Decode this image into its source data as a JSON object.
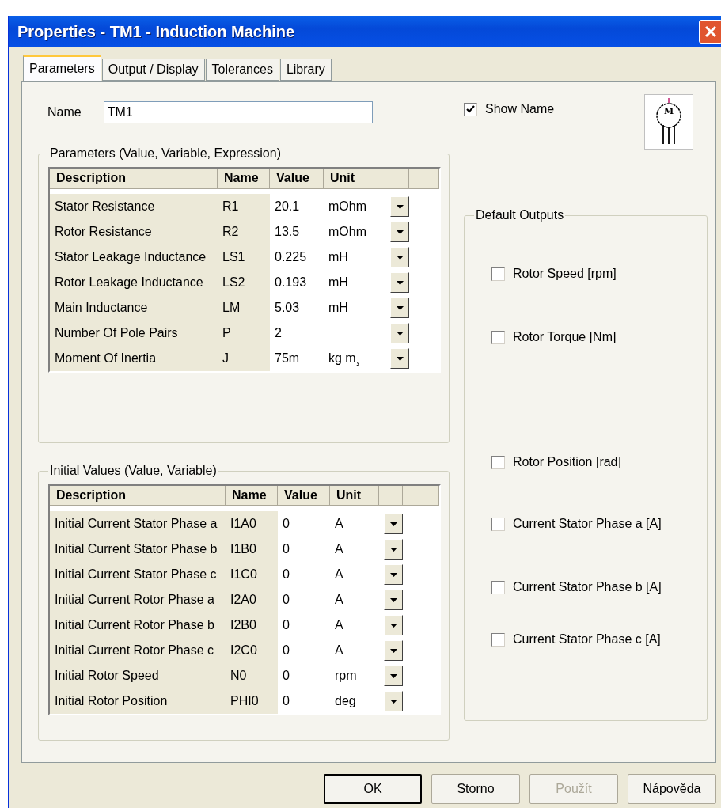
{
  "window": {
    "title": "Properties - TM1 - Induction Machine"
  },
  "tabs": [
    {
      "label": "Parameters",
      "selected": true
    },
    {
      "label": "Output / Display",
      "selected": false
    },
    {
      "label": "Tolerances",
      "selected": false
    },
    {
      "label": "Library",
      "selected": false
    }
  ],
  "name_field": {
    "label": "Name",
    "value": "TM1"
  },
  "show_name": {
    "label": "Show Name",
    "checked": true
  },
  "symbol": {
    "letter": "M"
  },
  "parameters": {
    "title": "Parameters (Value, Variable, Expression)",
    "columns": [
      "Description",
      "Name",
      "Value",
      "Unit"
    ],
    "rows": [
      {
        "description": "Stator Resistance",
        "name": "R1",
        "value": "20.1",
        "unit": "mOhm"
      },
      {
        "description": "Rotor Resistance",
        "name": "R2",
        "value": "13.5",
        "unit": "mOhm"
      },
      {
        "description": "Stator Leakage Inductance",
        "name": "LS1",
        "value": "0.225",
        "unit": "mH"
      },
      {
        "description": "Rotor Leakage Inductance",
        "name": "LS2",
        "value": "0.193",
        "unit": "mH"
      },
      {
        "description": "Main Inductance",
        "name": "LM",
        "value": "5.03",
        "unit": "mH"
      },
      {
        "description": "Number Of Pole Pairs",
        "name": "P",
        "value": "2"
      },
      {
        "description": "Moment Of Inertia",
        "name": "J",
        "value": "75m",
        "unit": "kg m¸"
      }
    ]
  },
  "initial_values": {
    "title": "Initial Values (Value, Variable)",
    "columns": [
      "Description",
      "Name",
      "Value",
      "Unit"
    ],
    "rows": [
      {
        "description": "Initial Current Stator Phase a",
        "name": "I1A0",
        "value": "0",
        "unit": "A"
      },
      {
        "description": "Initial Current Stator Phase b",
        "name": "I1B0",
        "value": "0",
        "unit": "A"
      },
      {
        "description": "Initial Current Stator Phase c",
        "name": "I1C0",
        "value": "0",
        "unit": "A"
      },
      {
        "description": "Initial Current Rotor Phase a",
        "name": "I2A0",
        "value": "0",
        "unit": "A"
      },
      {
        "description": "Initial Current Rotor Phase b",
        "name": "I2B0",
        "value": "0",
        "unit": "A"
      },
      {
        "description": "Initial Current Rotor Phase c",
        "name": "I2C0",
        "value": "0",
        "unit": "A"
      },
      {
        "description": "Initial Rotor Speed",
        "name": "N0",
        "value": "0",
        "unit": "rpm"
      },
      {
        "description": "Initial Rotor Position",
        "name": "PHI0",
        "value": "0",
        "unit": "deg"
      }
    ]
  },
  "default_outputs": {
    "title": "Default Outputs",
    "items": [
      {
        "label": "Rotor Speed [rpm]",
        "checked": false
      },
      {
        "label": "Rotor Torque [Nm]",
        "checked": false
      },
      {
        "label": "Rotor Position [rad]",
        "checked": false
      },
      {
        "label": "Current Stator Phase a [A]",
        "checked": false
      },
      {
        "label": "Current Stator Phase b [A]",
        "checked": false
      },
      {
        "label": "Current Stator Phase c [A]",
        "checked": false
      }
    ]
  },
  "buttons": [
    {
      "label": "OK",
      "kind": "default",
      "disabled": false
    },
    {
      "label": "Storno",
      "kind": "normal",
      "disabled": false
    },
    {
      "label": "Použít",
      "kind": "normal",
      "disabled": true
    },
    {
      "label": "Nápověda",
      "kind": "normal",
      "disabled": false
    }
  ]
}
